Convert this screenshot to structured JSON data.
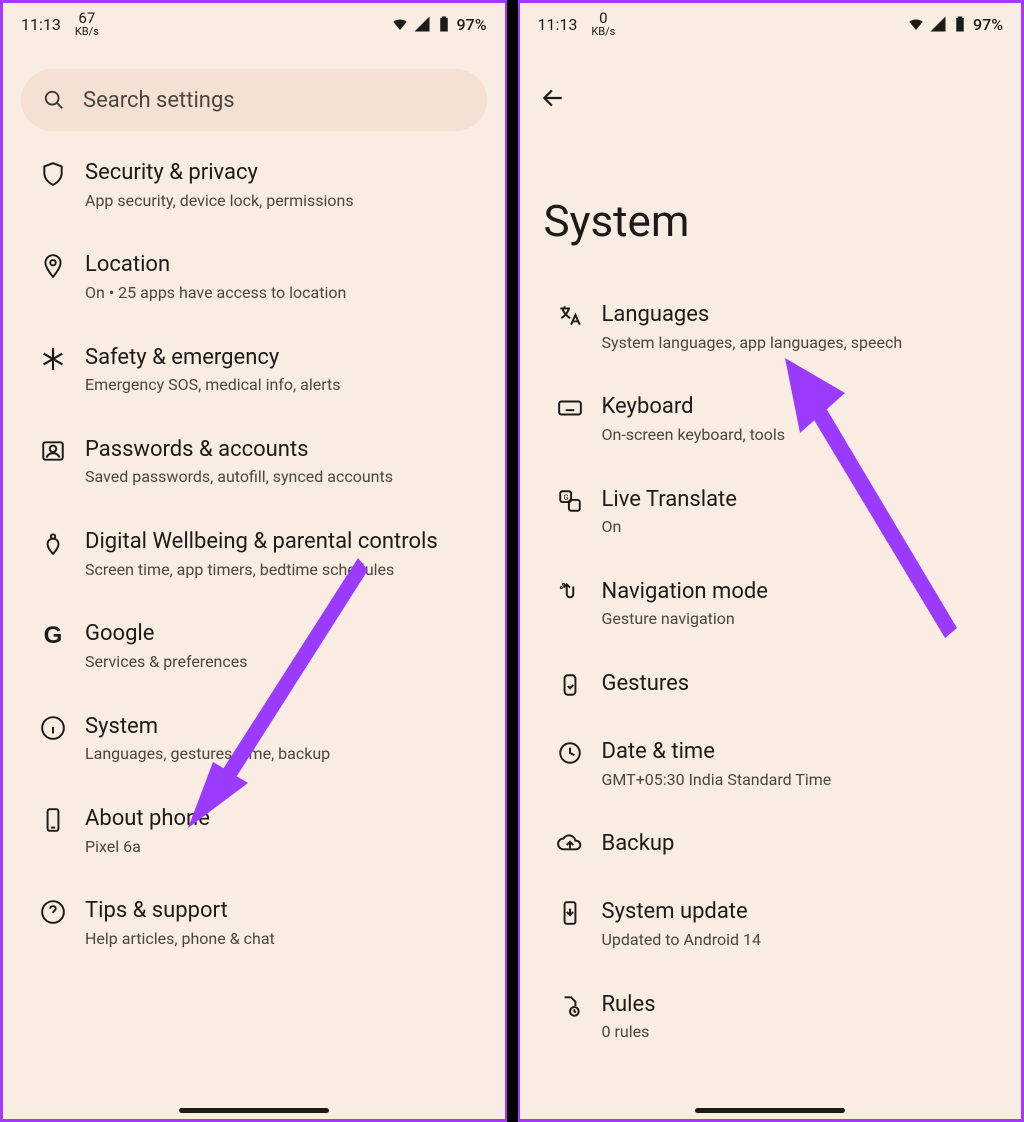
{
  "status": {
    "time": "11:13",
    "kbs_left": "67",
    "kbs_right": "0",
    "kbs_unit": "KB/s",
    "battery": "97%"
  },
  "left": {
    "search_placeholder": "Search settings",
    "items": [
      {
        "icon": "shield",
        "title": "Security & privacy",
        "sub": "App security, device lock, permissions"
      },
      {
        "icon": "pin",
        "title": "Location",
        "sub": "On • 25 apps have access to location"
      },
      {
        "icon": "asterisk",
        "title": "Safety & emergency",
        "sub": "Emergency SOS, medical info, alerts"
      },
      {
        "icon": "account",
        "title": "Passwords & accounts",
        "sub": "Saved passwords, autofill, synced accounts"
      },
      {
        "icon": "wellbeing",
        "title": "Digital Wellbeing & parental controls",
        "sub": "Screen time, app timers, bedtime schedules"
      },
      {
        "icon": "google",
        "title": "Google",
        "sub": "Services & preferences"
      },
      {
        "icon": "info",
        "title": "System",
        "sub": "Languages, gestures, time, backup"
      },
      {
        "icon": "phone",
        "title": "About phone",
        "sub": "Pixel 6a"
      },
      {
        "icon": "help",
        "title": "Tips & support",
        "sub": "Help articles, phone & chat"
      }
    ]
  },
  "right": {
    "page_title": "System",
    "items": [
      {
        "icon": "translate",
        "title": "Languages",
        "sub": "System languages, app languages, speech"
      },
      {
        "icon": "keyboard",
        "title": "Keyboard",
        "sub": "On-screen keyboard, tools"
      },
      {
        "icon": "gtranslate",
        "title": "Live Translate",
        "sub": "On"
      },
      {
        "icon": "nav",
        "title": "Navigation mode",
        "sub": "Gesture navigation"
      },
      {
        "icon": "gestures",
        "title": "Gestures",
        "sub": ""
      },
      {
        "icon": "clock",
        "title": "Date & time",
        "sub": "GMT+05:30 India Standard Time"
      },
      {
        "icon": "backup",
        "title": "Backup",
        "sub": ""
      },
      {
        "icon": "update",
        "title": "System update",
        "sub": "Updated to Android 14"
      },
      {
        "icon": "rules",
        "title": "Rules",
        "sub": "0 rules"
      }
    ]
  }
}
